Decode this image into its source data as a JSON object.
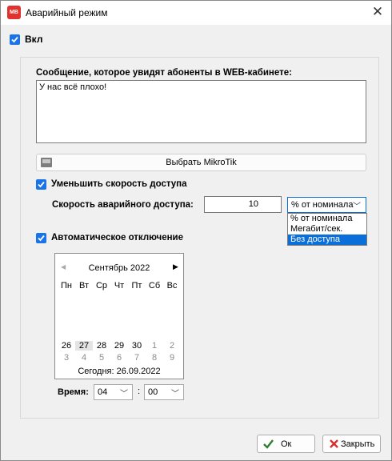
{
  "window": {
    "title": "Аварийный режим",
    "close_glyph": "✕",
    "app_icon_text": "MB"
  },
  "enable": {
    "label": "Вкл",
    "checked": true
  },
  "message": {
    "label": "Сообщение, которое увидят абоненты в WEB-кабинете:",
    "value": "У нас всё плохо!"
  },
  "mikrotik_button": {
    "label": "Выбрать MikroTik",
    "icon": "router-icon"
  },
  "reduce_speed": {
    "label": "Уменьшить скорость доступа",
    "checked": true,
    "speed_label": "Скорость аварийного доступа:",
    "speed_value": "10",
    "unit_selected": "% от номинала",
    "unit_options": [
      "% от номинала",
      "Мегабит/сек.",
      "Без доступа"
    ],
    "unit_highlighted": "Без доступа"
  },
  "auto_off": {
    "label": "Автоматическое отключение",
    "checked": true,
    "calendar": {
      "month_title": "Сентябрь 2022",
      "prev_glyph": "◀",
      "next_glyph": "▶",
      "weekdays": [
        "Пн",
        "Вт",
        "Ср",
        "Чт",
        "Пт",
        "Сб",
        "Вс"
      ],
      "row1": [
        "26",
        "27",
        "28",
        "29",
        "30",
        "1",
        "2"
      ],
      "row2": [
        "3",
        "4",
        "5",
        "6",
        "7",
        "8",
        "9"
      ],
      "today_label": "Сегодня: 26.09.2022",
      "highlighted_day": "27"
    },
    "time_label": "Время:",
    "hour": "04",
    "separator": ":",
    "minute": "00"
  },
  "buttons": {
    "ok": "Ок",
    "close": "Закрыть"
  },
  "colors": {
    "accent": "#1a73e8",
    "selection": "#0a6fd8",
    "close_red": "#d32f2f",
    "ok_green": "#2e7d32"
  }
}
